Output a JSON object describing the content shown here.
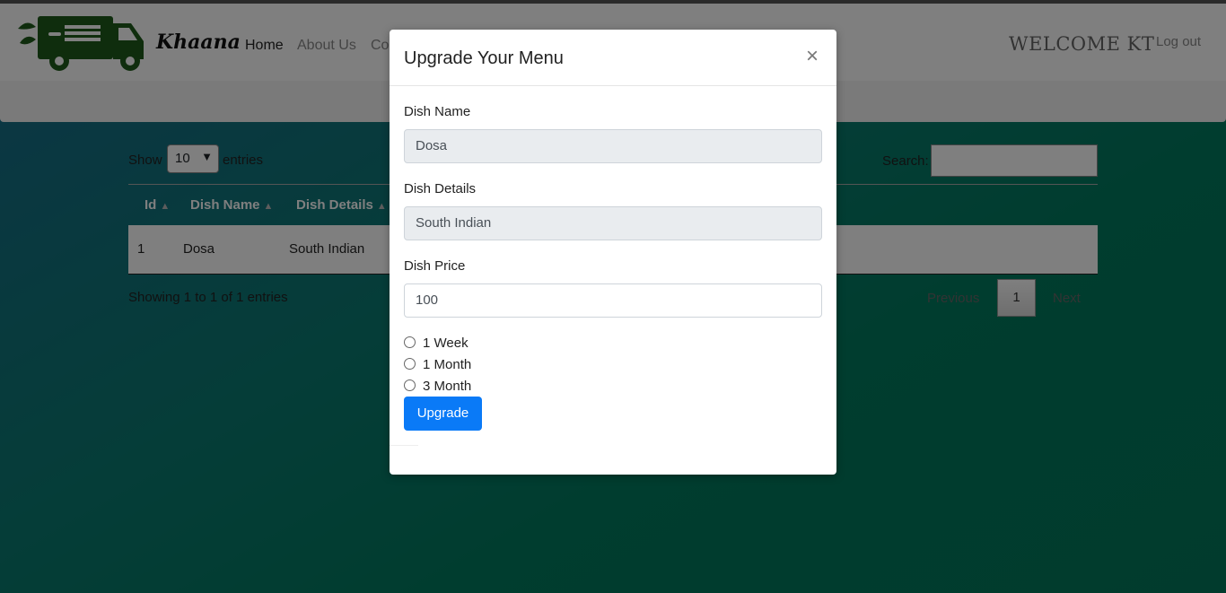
{
  "nav": {
    "brand": "Khaana",
    "links": [
      "Home",
      "About Us",
      "Co"
    ],
    "welcome": "WELCOME KT",
    "logout": "Log out"
  },
  "table_controls": {
    "show_label": "Show",
    "entries_value": "10",
    "entries_label": "entries",
    "search_label": "Search:",
    "search_value": ""
  },
  "table": {
    "headers": [
      "Id",
      "Dish Name",
      "Dish Details"
    ],
    "rows": [
      {
        "id": "1",
        "dish_name": "Dosa",
        "dish_details": "South Indian"
      }
    ],
    "info": "Showing 1 to 1 of 1 entries",
    "pagination": {
      "previous": "Previous",
      "current": "1",
      "next": "Next"
    }
  },
  "modal": {
    "title": "Upgrade Your Menu",
    "close": "×",
    "dish_name_label": "Dish Name",
    "dish_name_value": "Dosa",
    "dish_details_label": "Dish Details",
    "dish_details_value": "South Indian",
    "dish_price_label": "Dish Price",
    "dish_price_value": "100",
    "options": [
      "1 Week",
      "1 Month",
      "3 Month"
    ],
    "submit_label": "Upgrade"
  },
  "colors": {
    "primary_button": "#0a7af7",
    "logo_green": "#1f5a1a"
  }
}
